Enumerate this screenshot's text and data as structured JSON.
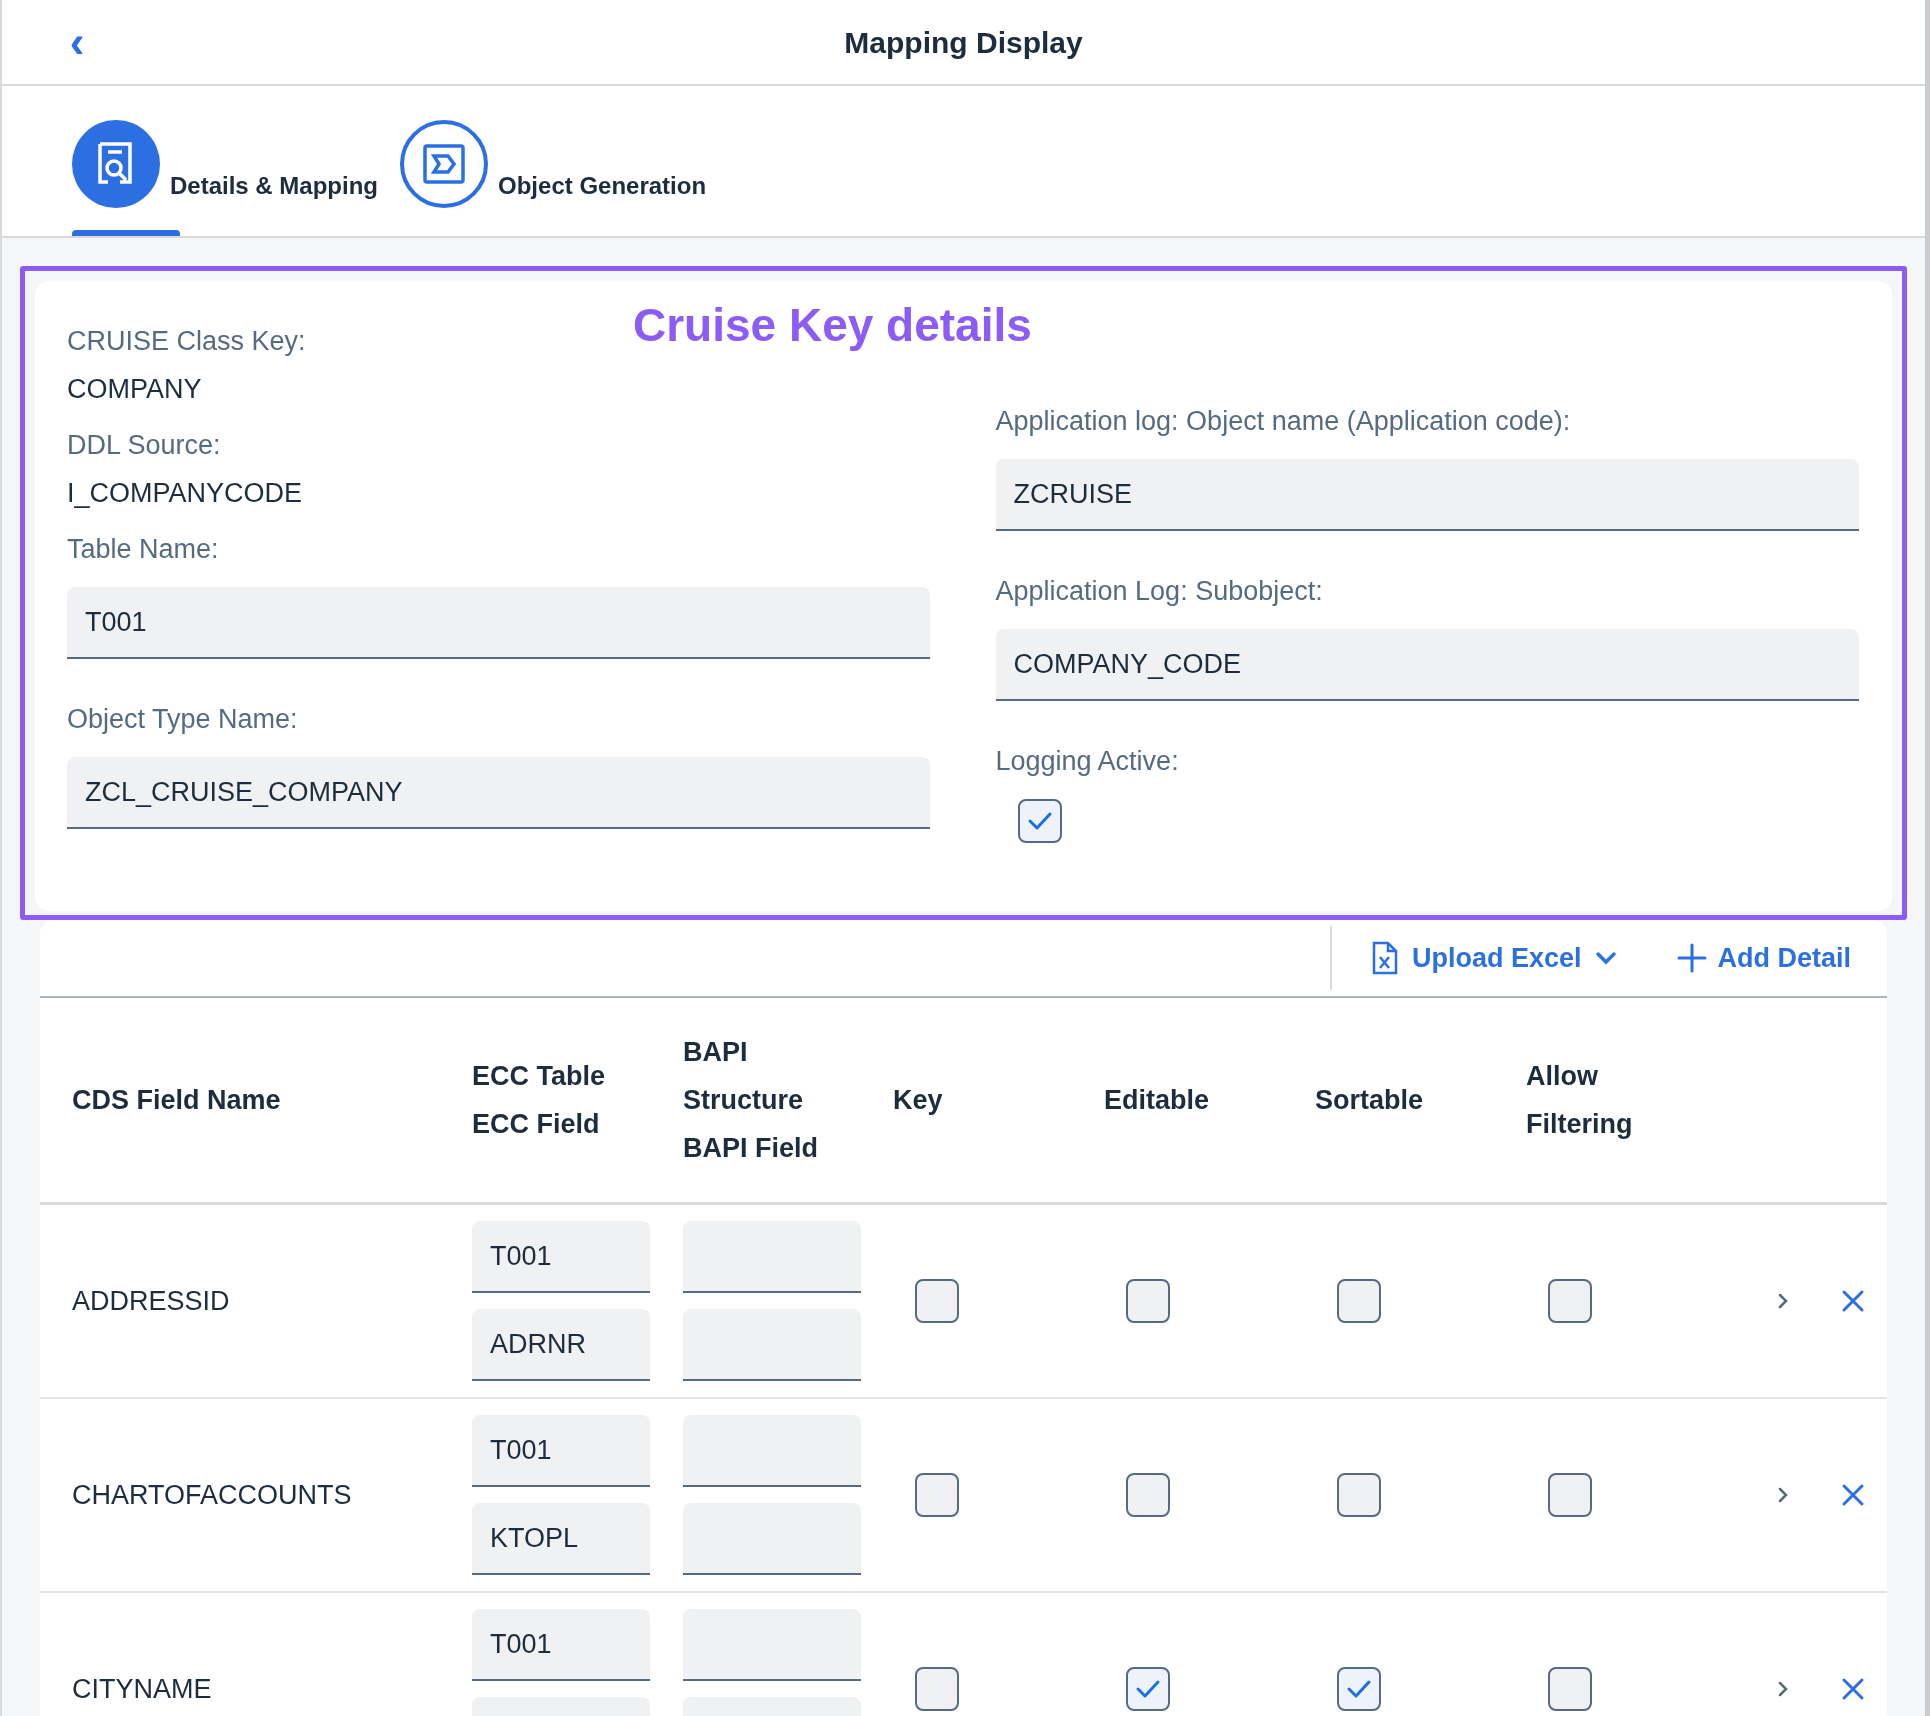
{
  "header": {
    "back": "‹",
    "title": "Mapping Display"
  },
  "steps": [
    {
      "label": "Details & Mapping",
      "kind": "details",
      "selected": true
    },
    {
      "label": "Object Generation",
      "kind": "generation",
      "selected": false
    }
  ],
  "annotation": {
    "title": "Cruise Key details"
  },
  "form": {
    "left": [
      {
        "kind": "text",
        "label": "CRUISE Class Key:",
        "value": "COMPANY"
      },
      {
        "kind": "text",
        "label": "DDL Source:",
        "value": "I_COMPANYCODE"
      },
      {
        "kind": "input",
        "label": "Table Name:",
        "value": "T001"
      },
      {
        "kind": "input",
        "label": "Object Type Name:",
        "value": "ZCL_CRUISE_COMPANY"
      }
    ],
    "right": [
      {
        "kind": "input",
        "label": "Application log: Object name (Application code):",
        "value": "ZCRUISE"
      },
      {
        "kind": "input",
        "label": "Application Log: Subobject:",
        "value": "COMPANY_CODE"
      },
      {
        "kind": "checkbox",
        "label": "Logging Active:",
        "checked": true
      }
    ]
  },
  "toolbar": {
    "upload": "Upload Excel",
    "add": "Add Detail"
  },
  "table": {
    "columns": [
      [
        "CDS Field Name"
      ],
      [
        "ECC Table",
        "ECC Field"
      ],
      [
        "BAPI",
        "Structure",
        "BAPI Field"
      ],
      [
        "Key"
      ],
      [
        "Editable"
      ],
      [
        "Sortable"
      ],
      [
        "Allow",
        "Filtering"
      ]
    ],
    "rows": [
      {
        "cds_field": "ADDRESSID",
        "ecc_table": "T001",
        "ecc_field": "ADRNR",
        "key": false,
        "editable": false,
        "sortable": false,
        "filtering": false
      },
      {
        "cds_field": "CHARTOFACCOUNTS",
        "ecc_table": "T001",
        "ecc_field": "KTOPL",
        "key": false,
        "editable": false,
        "sortable": false,
        "filtering": false
      },
      {
        "cds_field": "CITYNAME",
        "ecc_table": "T001",
        "key": false,
        "editable": true,
        "sortable": true,
        "filtering": false
      }
    ]
  }
}
